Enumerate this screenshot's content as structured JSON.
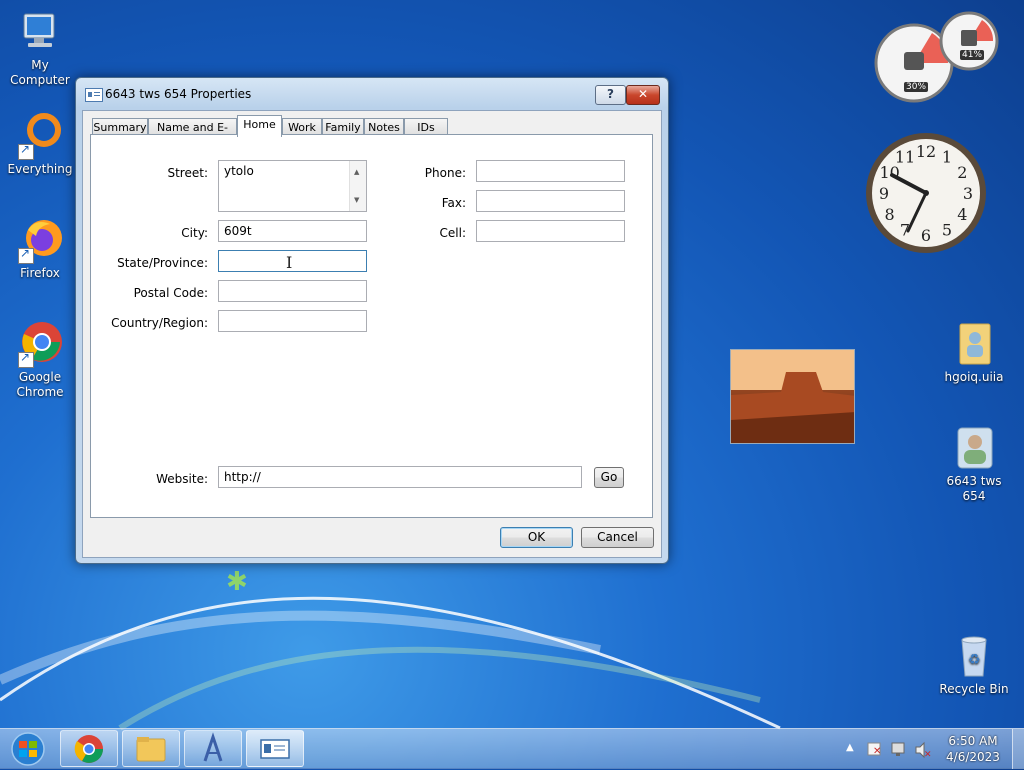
{
  "desktop": {
    "icons": [
      {
        "label": "My Computer"
      },
      {
        "label": "Everything"
      },
      {
        "label": "Firefox"
      },
      {
        "label": "Google Chrome"
      },
      {
        "label": "hgoiq.uiia"
      },
      {
        "label": "6643 tws 654"
      },
      {
        "label": "Recycle Bin"
      }
    ]
  },
  "gadgets": {
    "cpu_meter": {
      "cpu_percent": "30%",
      "memory_percent": "41%"
    },
    "clock": {
      "numerals": [
        "12",
        "1",
        "2",
        "3",
        "4",
        "5",
        "6",
        "7",
        "8",
        "9",
        "10",
        "11"
      ],
      "time": "6:50"
    }
  },
  "window": {
    "title": "6643 tws 654 Properties",
    "help_label": "?",
    "close_label": "✕",
    "tabs": [
      {
        "label": "Summary",
        "active": false
      },
      {
        "label": "Name and E-mail",
        "active": false
      },
      {
        "label": "Home",
        "active": true
      },
      {
        "label": "Work",
        "active": false
      },
      {
        "label": "Family",
        "active": false
      },
      {
        "label": "Notes",
        "active": false
      },
      {
        "label": "IDs",
        "active": false
      }
    ],
    "home": {
      "street_label": "Street:",
      "street_value": "ytolo",
      "city_label": "City:",
      "city_value": "609t",
      "state_label": "State/Province:",
      "state_value": "",
      "postal_label": "Postal Code:",
      "postal_value": "",
      "country_label": "Country/Region:",
      "country_value": "",
      "phone_label": "Phone:",
      "phone_value": "",
      "fax_label": "Fax:",
      "fax_value": "",
      "cell_label": "Cell:",
      "cell_value": "",
      "website_label": "Website:",
      "website_value": "http://",
      "go_label": "Go"
    },
    "ok_label": "OK",
    "cancel_label": "Cancel"
  },
  "taskbar": {
    "items": [
      "chrome-icon",
      "explorer-icon",
      "app-icon",
      "contact-properties-icon"
    ],
    "time": "6:50 AM",
    "date": "4/6/2023"
  },
  "colors": {
    "accent": "#3c7fb1",
    "desktop": "#1f6fd0"
  }
}
